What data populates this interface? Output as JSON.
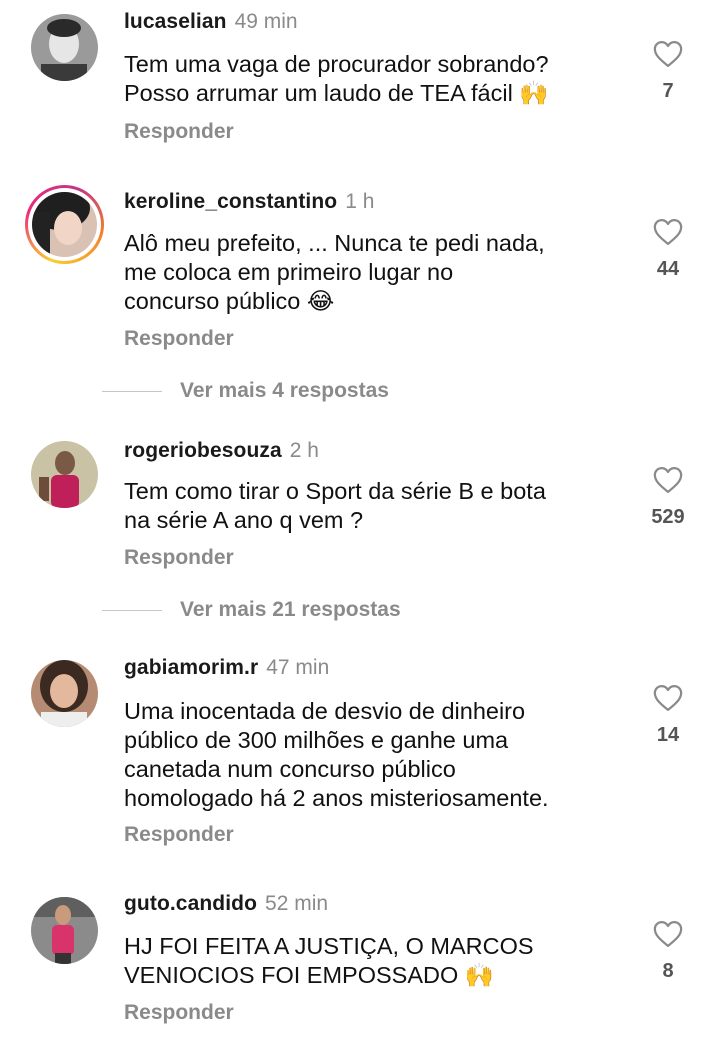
{
  "comments": [
    {
      "username": "lucaselian",
      "time": "49 min",
      "text": "Tem uma vaga de procurador sobrando?\nPosso arrumar um laudo de TEA fácil 🙌",
      "likes": "7",
      "reply": "Responder"
    },
    {
      "username": "keroline_constantino",
      "time": "1 h",
      "text": "Alô meu prefeito, ... Nunca te pedi nada,\nme coloca em primeiro lugar no\nconcurso público 😂",
      "likes": "44",
      "reply": "Responder",
      "more_replies": "Ver mais 4 respostas"
    },
    {
      "username": "rogeriobesouza",
      "time": "2 h",
      "text": "Tem como tirar o Sport da série B e bota\nna série A ano q vem ?",
      "likes": "529",
      "reply": "Responder",
      "more_replies": "Ver mais 21 respostas"
    },
    {
      "username": "gabiamorim.r",
      "time": "47 min",
      "text": "Uma inocentada de desvio de dinheiro\npúblico de 300 milhões e ganhe uma\ncanetada num concurso público\nhomologado há 2 anos misteriosamente.",
      "likes": "14",
      "reply": "Responder"
    },
    {
      "username": "guto.candido",
      "time": "52 min",
      "text": "HJ FOI FEITA A JUSTIÇA, O MARCOS\nVENIOCIOS FOI EMPOSSADO 🙌",
      "likes": "8",
      "reply": "Responder"
    }
  ],
  "icons": {
    "like": "heart-outline-icon",
    "avatar": "avatar-photo"
  },
  "colors": {
    "secondary_text": "#8a8a8a",
    "story_ring": "#ee2a7b"
  }
}
